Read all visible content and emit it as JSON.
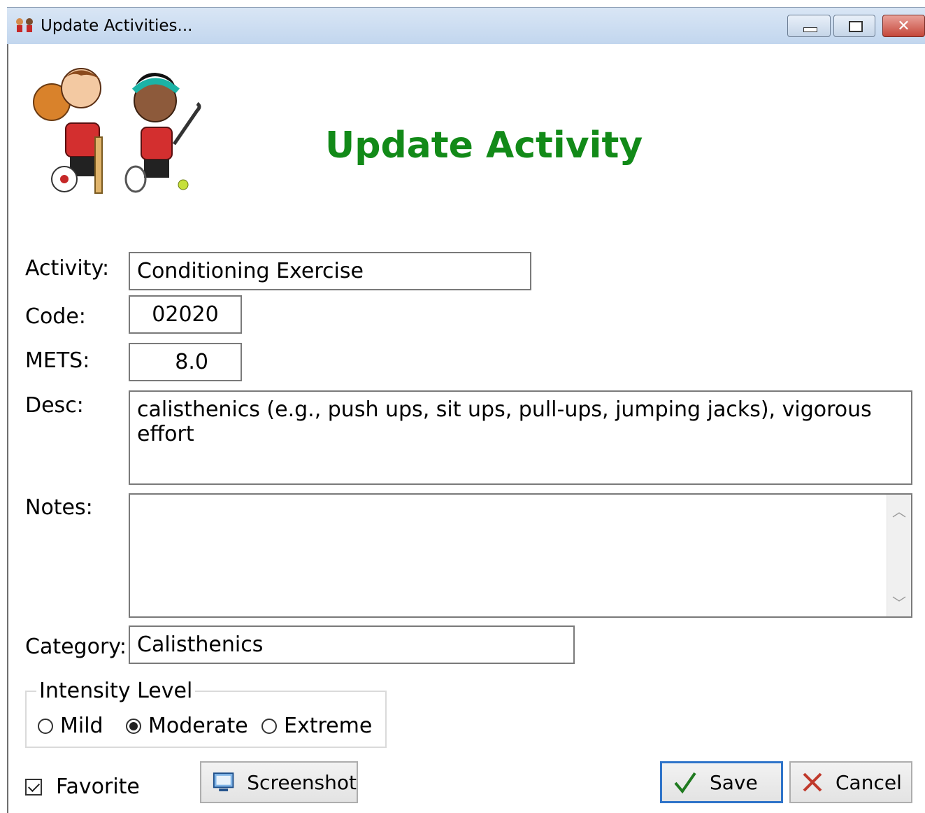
{
  "window": {
    "title": "Update Activities...",
    "close_glyph": "✕"
  },
  "heading": "Update Activity",
  "form": {
    "activity": {
      "label": "Activity:",
      "value": "Conditioning Exercise"
    },
    "code": {
      "label": "Code:",
      "value": "02020"
    },
    "mets": {
      "label": "METS:",
      "value": "8.0"
    },
    "desc": {
      "label": "Desc:",
      "value": "calisthenics (e.g., push ups, sit ups, pull-ups, jumping jacks), vigorous effort"
    },
    "notes": {
      "label": "Notes:",
      "value": ""
    },
    "category": {
      "label": "Category:",
      "value": "Calisthenics"
    }
  },
  "intensity": {
    "legend": "Intensity Level",
    "options": [
      "Mild",
      "Moderate",
      "Extreme"
    ],
    "selected": "Moderate"
  },
  "favorite": {
    "label": "Favorite",
    "checked": true
  },
  "buttons": {
    "screenshot": "Screenshot",
    "save": "Save",
    "cancel": "Cancel"
  },
  "colors": {
    "heading": "#128a18",
    "default_button_border": "#2f74c9",
    "save_check": "#1f7a1f",
    "cancel_x": "#c0392b"
  },
  "icons": {
    "app": "kids-sports-icon",
    "screenshot": "screenshot-icon",
    "save": "checkmark-icon",
    "cancel": "x-icon"
  }
}
